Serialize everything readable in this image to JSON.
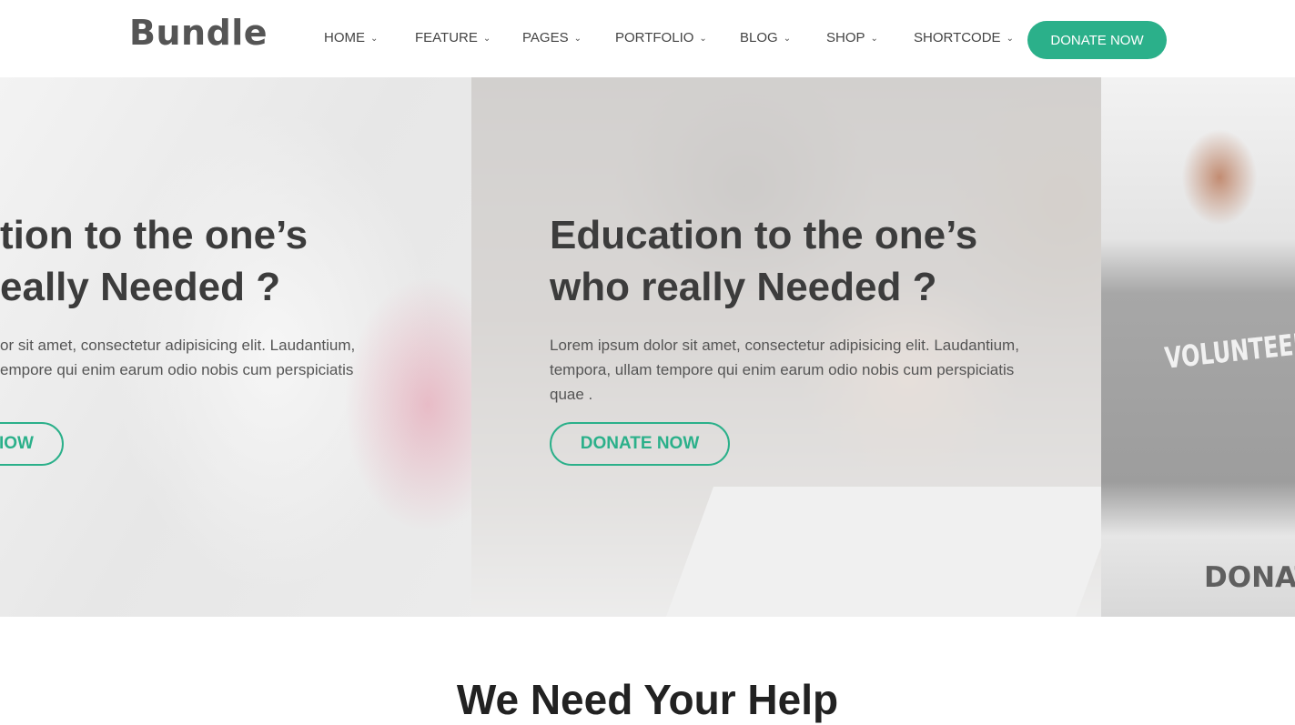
{
  "brand": {
    "logo": "Bundle",
    "accent": "#2bb08a"
  },
  "nav": {
    "items": [
      {
        "label": "HOME"
      },
      {
        "label": "FEATURE"
      },
      {
        "label": "PAGES"
      },
      {
        "label": "PORTFOLIO"
      },
      {
        "label": "BLOG"
      },
      {
        "label": "SHOP"
      },
      {
        "label": "SHORTCODE"
      }
    ],
    "chevron": "chevron-down-icon",
    "cta": "DONATE NOW"
  },
  "hero": {
    "slide_prev": {
      "title_line1": "tion to the one’s",
      "title_line2": "eally Needed ?",
      "text_line1": "or sit amet, consectetur adipisicing elit. Laudantium,",
      "text_line2": "empore qui enim earum odio nobis cum perspiciatis",
      "button": "IOW"
    },
    "slide_current": {
      "title_line1": "Education to the one’s",
      "title_line2": "who really Needed ?",
      "text_line1": "Lorem ipsum dolor sit amet, consectetur adipisicing elit. Laudantium,",
      "text_line2": "tempora, ullam tempore qui enim earum odio nobis cum perspiciatis",
      "text_line3": "quae .",
      "button": "DONATE NOW"
    },
    "slide_next": {
      "shirt_text": "VOLUNTEER",
      "box_text": "DONAT"
    }
  },
  "help": {
    "title": "We Need Your Help"
  }
}
